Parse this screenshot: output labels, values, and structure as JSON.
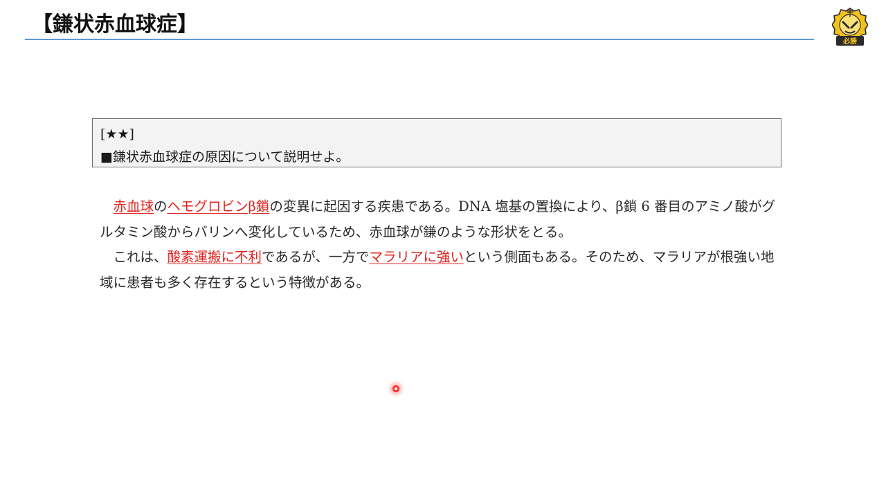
{
  "slide": {
    "title": "【鎌状赤血球症】"
  },
  "logo": {
    "icon": "hisshou-emblem-icon",
    "top_char": "丰",
    "label": "必勝",
    "colors": {
      "gold": "#f2c21b",
      "dark": "#2b2b2b",
      "red": "#c0392b"
    }
  },
  "question": {
    "rating": "[★★]",
    "text": "■鎌状赤血球症の原因について説明せよ。"
  },
  "answer": {
    "p1": [
      {
        "text": "赤血球",
        "highlight": true
      },
      {
        "text": "の",
        "highlight": false
      },
      {
        "text": "ヘモグロビンβ鎖",
        "highlight": true
      },
      {
        "text": "の変異に起因する疾患である。DNA 塩基の置換により、β鎖 6 番目のアミノ酸がグルタミン酸からバリンへ変化しているため、赤血球が鎌のような形状をとる。",
        "highlight": false
      }
    ],
    "p2": [
      {
        "text": "これは、",
        "highlight": false
      },
      {
        "text": "酸素運搬に不利",
        "highlight": true
      },
      {
        "text": "であるが、一方で",
        "highlight": false
      },
      {
        "text": "マラリアに強い",
        "highlight": true
      },
      {
        "text": "という側面もある。そのため、マラリアが根強い地域に患者も多く存在するという特徴がある。",
        "highlight": false
      }
    ]
  },
  "colors": {
    "accent_line": "#5b9bd5",
    "keyword": "#e0201b",
    "box_background": "#f3f3f3",
    "box_border": "#6d6d6d",
    "pointer": "#ff3030"
  }
}
